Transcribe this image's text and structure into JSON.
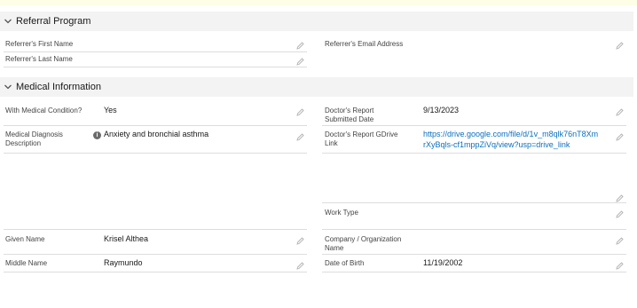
{
  "sections": {
    "referral": {
      "title": "Referral Program"
    },
    "medical": {
      "title": "Medical Information"
    }
  },
  "referral_fields": {
    "first_name": {
      "label": "Referrer's First Name",
      "value": ""
    },
    "last_name": {
      "label": "Referrer's Last Name",
      "value": ""
    },
    "email": {
      "label": "Referrer's Email Address",
      "value": ""
    }
  },
  "medical_fields": {
    "with_condition": {
      "label": "With Medical Condition?",
      "value": "Yes"
    },
    "report_date": {
      "label_line1": "Doctor's Report",
      "label_line2": "Submitted Date",
      "value": "9/13/2023"
    },
    "diagnosis": {
      "label_line1": "Medical Diagnosis",
      "label_line2": "Description",
      "value": "Anxiety and bronchial asthma"
    },
    "gdrive": {
      "label_line1": "Doctor's Report GDrive",
      "label_line2": "Link",
      "value_line1": "https://drive.google.com/file/d/1v_m8qlk76nT8Xm",
      "value_line2": "rXyBqls-cf1mppZiVq/view?usp=drive_link"
    },
    "work_type": {
      "label": "Work Type",
      "value": ""
    },
    "given_name": {
      "label": "Given Name",
      "value": "Krisel Althea"
    },
    "company": {
      "label_line1": "Company / Organization",
      "label_line2": "Name",
      "value": ""
    },
    "middle_name": {
      "label": "Middle Name",
      "value": "Raymundo"
    },
    "dob": {
      "label": "Date of Birth",
      "value": "11/19/2002"
    }
  },
  "icons": {
    "chevron": "chevron-down-icon",
    "edit": "pencil-icon",
    "info": "info-icon"
  },
  "colors": {
    "header_bg": "#f3f3f3",
    "link": "#0b6fbe",
    "divider": "#dddddd"
  }
}
